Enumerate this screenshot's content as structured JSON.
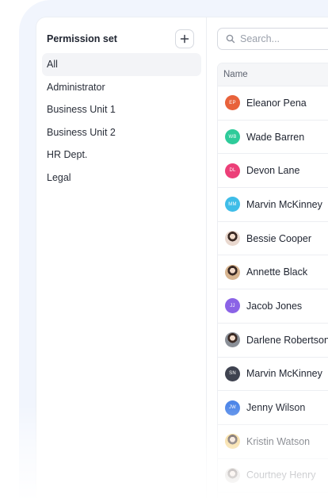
{
  "permission_panel": {
    "title": "Permission set",
    "add_button_icon": "plus-icon",
    "items": [
      {
        "label": "All",
        "active": true
      },
      {
        "label": "Administrator",
        "active": false
      },
      {
        "label": "Business Unit 1",
        "active": false
      },
      {
        "label": "Business Unit 2",
        "active": false
      },
      {
        "label": "HR Dept.",
        "active": false
      },
      {
        "label": "Legal",
        "active": false
      }
    ]
  },
  "search": {
    "placeholder": "Search...",
    "icon": "search-icon"
  },
  "table": {
    "column_header": "Name",
    "rows": [
      {
        "name": "Eleanor Pena",
        "initials": "EP",
        "avatar_type": "initials",
        "color": "#e8623b"
      },
      {
        "name": "Wade Barren",
        "initials": "WB",
        "avatar_type": "initials",
        "color": "#2ecb9a"
      },
      {
        "name": "Devon Lane",
        "initials": "DL",
        "avatar_type": "initials",
        "color": "#ec3f78"
      },
      {
        "name": "Marvin McKinney",
        "initials": "MM",
        "avatar_type": "initials",
        "color": "#3fbde8"
      },
      {
        "name": "Bessie Cooper",
        "initials": "",
        "avatar_type": "photo",
        "color": "#e9d8cf"
      },
      {
        "name": "Annette Black",
        "initials": "",
        "avatar_type": "photo",
        "color": "#d7b48f"
      },
      {
        "name": "Jacob Jones",
        "initials": "JJ",
        "avatar_type": "initials",
        "color": "#8b63e6"
      },
      {
        "name": "Darlene Robertson",
        "initials": "",
        "avatar_type": "photo",
        "color": "#8a8f97"
      },
      {
        "name": "Marvin McKinney",
        "initials": "SN",
        "avatar_type": "initials",
        "color": "#3f4350"
      },
      {
        "name": "Jenny Wilson",
        "initials": "JW",
        "avatar_type": "initials",
        "color": "#4e86e8"
      },
      {
        "name": "Kristin Watson",
        "initials": "",
        "avatar_type": "photo",
        "color": "#f2c96b"
      },
      {
        "name": "Courtney Henry",
        "initials": "",
        "avatar_type": "photo",
        "color": "#c9c3bd"
      }
    ]
  }
}
